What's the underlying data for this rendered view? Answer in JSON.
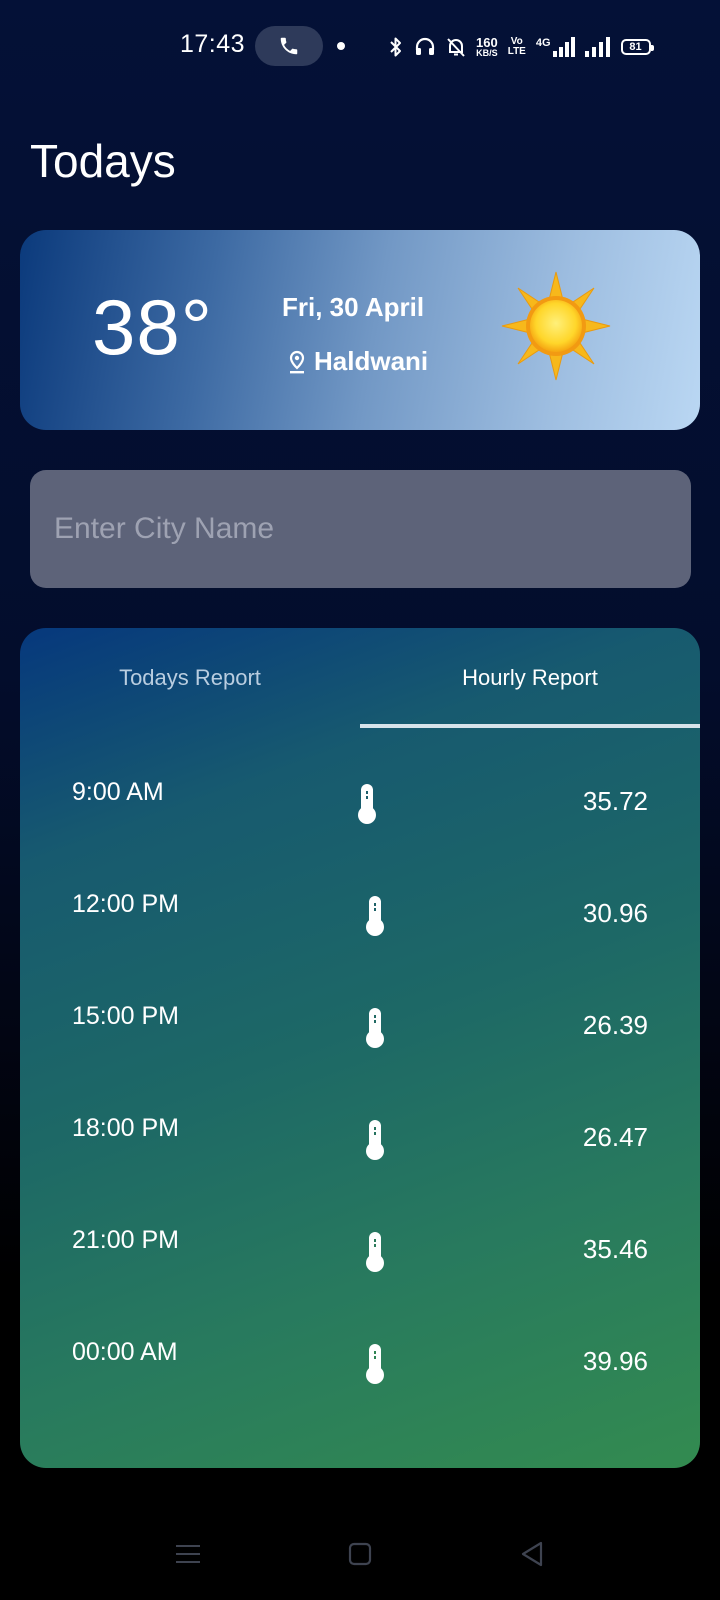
{
  "status_bar": {
    "time": "17:43",
    "network_speed": "160",
    "network_speed_unit": "KB/S",
    "volte_top": "Vo",
    "volte_bottom": "LTE",
    "network_type": "4G",
    "battery": "81",
    "icons": [
      "call-icon",
      "bluetooth-icon",
      "headphones-icon",
      "bell-mute-icon",
      "signal-icon",
      "signal-icon"
    ]
  },
  "header": {
    "title": "Todays"
  },
  "current": {
    "temperature": "38°",
    "date": "Fri, 30 April",
    "location": "Haldwani",
    "location_icon": "map-pin-icon",
    "condition_icon": "sun-icon"
  },
  "search": {
    "placeholder": "Enter City Name",
    "value": ""
  },
  "tabs": [
    {
      "label": "Todays Report",
      "active": false
    },
    {
      "label": "Hourly Report",
      "active": true
    }
  ],
  "hourly": [
    {
      "time": "9:00 AM",
      "temp": "35.72",
      "icon": "thermometer-icon"
    },
    {
      "time": "12:00 PM",
      "temp": "30.96",
      "icon": "thermometer-icon"
    },
    {
      "time": "15:00 PM",
      "temp": "26.39",
      "icon": "thermometer-icon"
    },
    {
      "time": "18:00 PM",
      "temp": "26.47",
      "icon": "thermometer-icon"
    },
    {
      "time": "21:00 PM",
      "temp": "35.46",
      "icon": "thermometer-icon"
    },
    {
      "time": "00:00 AM",
      "temp": "39.96",
      "icon": "thermometer-icon"
    }
  ],
  "nav": {
    "buttons": [
      "menu-icon",
      "home-icon",
      "back-icon"
    ]
  },
  "colors": {
    "background_top": "#041137",
    "background_bottom": "#000000",
    "card_gradient_start": "#0b3a7c",
    "card_gradient_end": "#bad7f3",
    "input_background": "#5d6379",
    "panel_gradient_start": "#06387d",
    "panel_gradient_end": "#338b50",
    "sun": "#f7b81b"
  }
}
